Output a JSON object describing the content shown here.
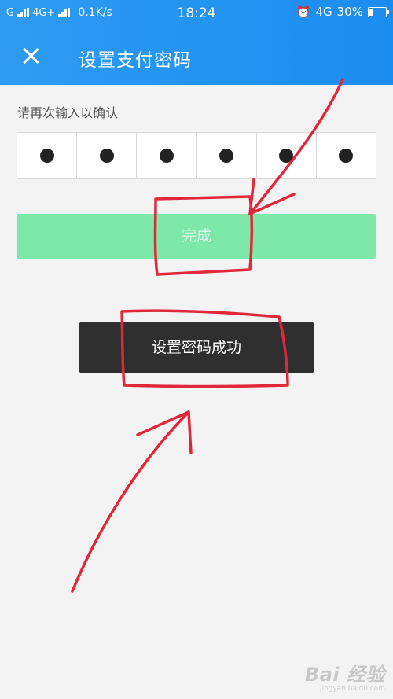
{
  "status_bar": {
    "carrier": "G",
    "network": "4G+",
    "speed": "0.1K/s",
    "time": "18:24",
    "network_right": "4G",
    "battery": "30%",
    "battery_level": 0.3
  },
  "header": {
    "title": "设置支付密码",
    "close_icon": "close-icon"
  },
  "form": {
    "hint": "请再次输入以确认",
    "pin_digits_filled": 6,
    "done_label": "完成"
  },
  "toast": {
    "message": "设置密码成功"
  },
  "watermark": {
    "logo": "Bai 经验",
    "url": "jingyan.baidu.com"
  },
  "colors": {
    "header": "#1a8df0",
    "done_button": "#7de8a8",
    "toast_bg": "#2f2f2f",
    "annotation": "#e0283a"
  }
}
